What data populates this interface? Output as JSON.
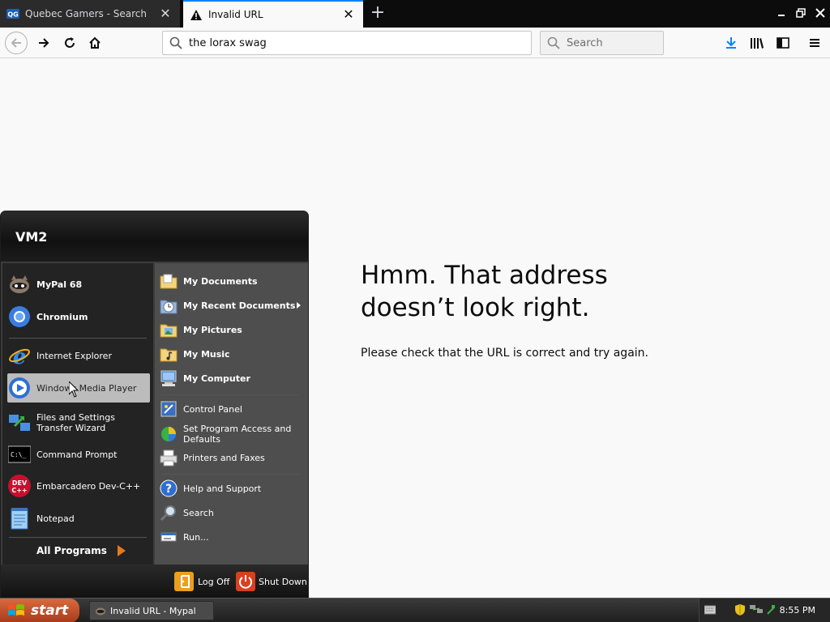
{
  "browser": {
    "tabs": [
      {
        "label": "Quebec Gamers - Search",
        "icon": "quebec-gamers-favicon",
        "active": false
      },
      {
        "label": "Invalid URL",
        "icon": "warning-icon",
        "active": true
      }
    ],
    "address": "the lorax swag",
    "search_placeholder": "Search",
    "accent_color": "#0a84ff"
  },
  "error_page": {
    "title": "Hmm. That address doesn’t look right.",
    "message": "Please check that the URL is correct and try again."
  },
  "start_menu": {
    "user": "VM2",
    "pinned": [
      {
        "label": "MyPal 68",
        "icon": "mypal-icon"
      },
      {
        "label": "Chromium",
        "icon": "chromium-icon"
      }
    ],
    "recent": [
      {
        "label": "Internet Explorer",
        "icon": "internet-explorer-icon"
      },
      {
        "label": "Windows Media Player",
        "icon": "windows-media-player-icon"
      },
      {
        "label": "Files and Settings Transfer Wizard",
        "icon": "transfer-wizard-icon"
      },
      {
        "label": "Command Prompt",
        "icon": "command-prompt-icon"
      },
      {
        "label": "Embarcadero Dev-C++",
        "icon": "devcpp-icon"
      },
      {
        "label": "Notepad",
        "icon": "notepad-icon"
      }
    ],
    "all_programs": "All Programs",
    "places": [
      {
        "label": "My Documents",
        "icon": "folder-icon"
      },
      {
        "label": "My Recent Documents",
        "icon": "recent-documents-icon"
      },
      {
        "label": "My Pictures",
        "icon": "pictures-folder-icon"
      },
      {
        "label": "My Music",
        "icon": "music-folder-icon"
      },
      {
        "label": "My Computer",
        "icon": "computer-icon"
      }
    ],
    "system": [
      {
        "label": "Control Panel",
        "icon": "control-panel-icon"
      },
      {
        "label": "Set Program Access and Defaults",
        "icon": "program-defaults-icon"
      },
      {
        "label": "Printers and Faxes",
        "icon": "printer-icon"
      }
    ],
    "help": [
      {
        "label": "Help and Support",
        "icon": "help-icon"
      },
      {
        "label": "Search",
        "icon": "search-icon"
      },
      {
        "label": "Run...",
        "icon": "run-icon"
      }
    ],
    "log_off": "Log Off",
    "shut_down": "Shut Down"
  },
  "taskbar": {
    "start_label": "start",
    "task_label": "Invalid URL - Mypal",
    "clock": "8:55 PM"
  }
}
